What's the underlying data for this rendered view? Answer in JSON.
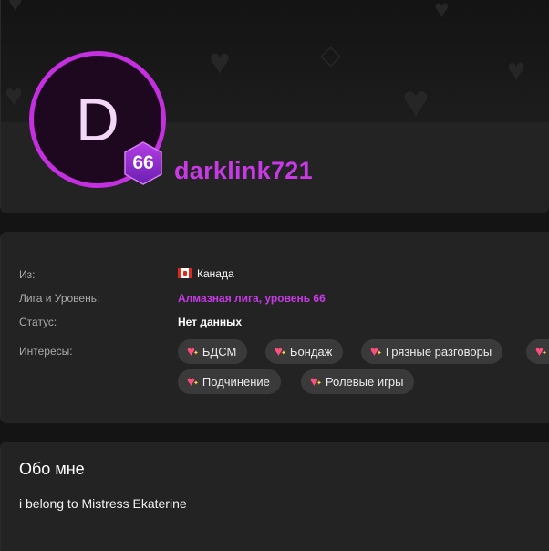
{
  "profile": {
    "avatar_letter": "D",
    "level": "66",
    "username": "darklink721"
  },
  "details": {
    "from_label": "Из:",
    "from_value": "Канада",
    "league_label": "Лига и Уровень:",
    "league_value": "Алмазная лига, уровень 66",
    "status_label": "Статус:",
    "status_value": "Нет данных",
    "interests_label": "Интересы:",
    "interests": [
      "БДСМ",
      "Бондаж",
      "Грязные разговоры",
      "",
      "Подчинение",
      "Ролевые игры"
    ]
  },
  "about": {
    "title": "Обо мне",
    "text": "i belong to Mistress Ekaterine"
  },
  "colors": {
    "accent": "#c73ae6",
    "ring": "#c42fe0",
    "badge": "#8a2bd0"
  },
  "icons": [
    "heart-sparkle-icon",
    "canada-flag-icon",
    "level-hexagon-icon"
  ]
}
